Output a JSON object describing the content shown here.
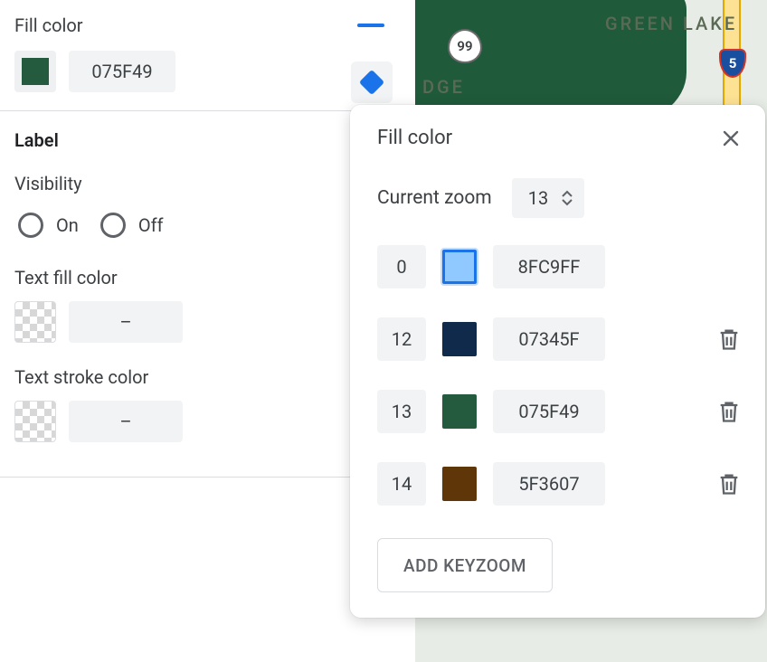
{
  "left": {
    "fill_section_title": "Fill color",
    "fill_hex": "075F49",
    "fill_swatch_color": "#245b3e",
    "label_section": "Label",
    "visibility_label": "Visibility",
    "visibility_on": "On",
    "visibility_off": "Off",
    "text_fill_label": "Text fill color",
    "text_fill_value": "–",
    "text_stroke_label": "Text stroke color",
    "text_stroke_value": "–"
  },
  "map": {
    "place_label": "GREEN LAKE",
    "trunc_label": "DGE",
    "highway_99": "99",
    "interstate_5": "5"
  },
  "popover": {
    "title": "Fill color",
    "current_zoom_label": "Current zoom",
    "current_zoom_value": "13",
    "keyzooms": [
      {
        "zoom": "0",
        "color": "#8FC9FF",
        "hex": "8FC9FF",
        "selected": true,
        "deletable": false
      },
      {
        "zoom": "12",
        "color": "#0f2a4a",
        "hex": "07345F",
        "selected": false,
        "deletable": true
      },
      {
        "zoom": "13",
        "color": "#245b3e",
        "hex": "075F49",
        "selected": false,
        "deletable": true
      },
      {
        "zoom": "14",
        "color": "#5F3607",
        "hex": "5F3607",
        "selected": false,
        "deletable": true
      }
    ],
    "add_label": "ADD KEYZOOM"
  }
}
